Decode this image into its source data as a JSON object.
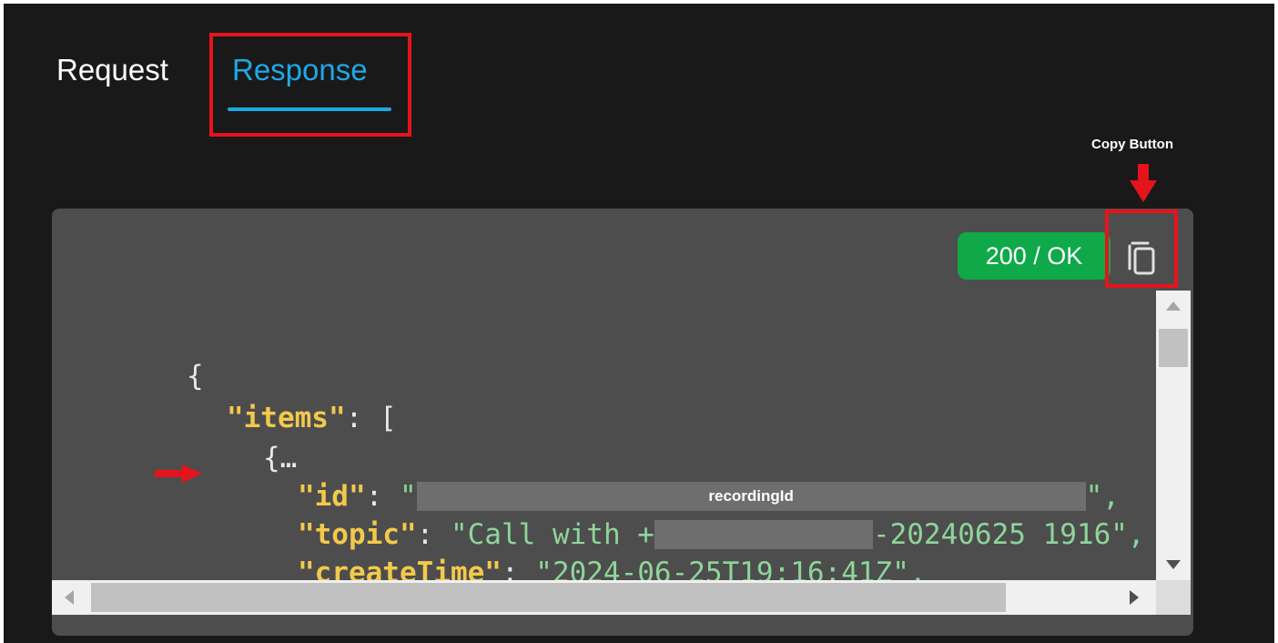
{
  "tabs": {
    "request_label": "Request",
    "response_label": "Response",
    "active": "Response"
  },
  "annotations": {
    "copy_button_caption": "Copy Button",
    "redact_label": "recordingId",
    "highlight_color": "#e5141c"
  },
  "status": {
    "label": "200 / OK",
    "color": "#0fa94a"
  },
  "code": {
    "brace_open": "{",
    "items_key": "\"items\"",
    "colon": ": ",
    "bracket_open": "[",
    "obj_open": "{…",
    "id_key": "\"id\"",
    "quote": "\"",
    "quote_comma": "\",",
    "topic_key": "\"topic\"",
    "topic_prefix": "\"Call with +",
    "topic_suffix": "-20240625 1916\",",
    "createTime_key": "\"createTime\"",
    "createTime_value": "\"2024-06-25T19:16:41Z\",",
    "key_color": "#f2c94c",
    "string_color": "#8ed59a"
  },
  "icons": {
    "copy": "copy-icon",
    "arrow_down": "arrow-down-icon",
    "pointer_arrow": "arrow-right-icon"
  }
}
